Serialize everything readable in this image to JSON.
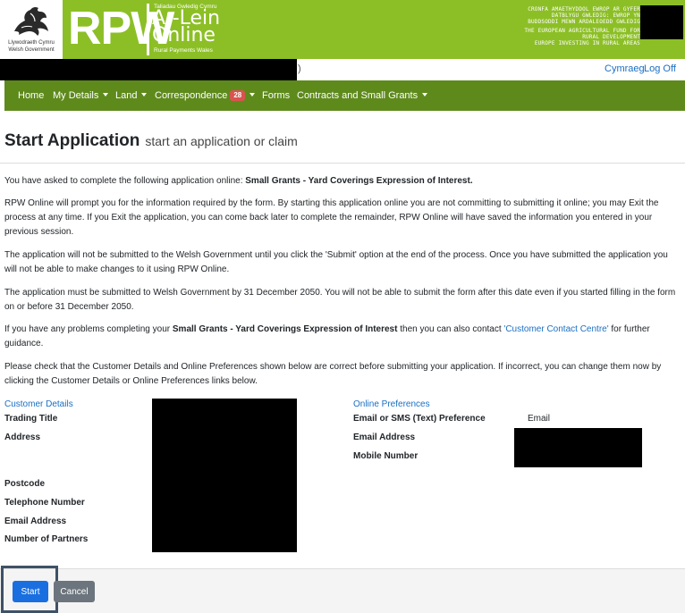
{
  "header": {
    "gov_name_cy": "Llywodraeth Cymru",
    "gov_name_en": "Welsh Government",
    "brand": "RPW",
    "brand_top_small": "Taliadau Gwledig Cymru",
    "brand_line1": "Ar-Lein",
    "brand_line2": "Online",
    "brand_bottom_small": "Rural Payments Wales",
    "eu_lines_cy": [
      "CRONFA AMAETHYDDOL EWROP AR GYFER",
      "DATBLYGU GWLEDIG: EWROP YN",
      "BUDDSODDI MEWN ARDALEOEDD GWLEDIG"
    ],
    "eu_lines_en": [
      "THE EUROPEAN AGRICULTURAL FUND FOR",
      "RURAL DEVELOPMENT",
      "EUROPE INVESTING IN RURAL AREAS"
    ],
    "colors": {
      "green": "#8cbf26",
      "nav_green": "#5e8a1c"
    }
  },
  "utility": {
    "user_suffix": ")",
    "cymraeg": "Cymraeg",
    "logoff": "Log Off"
  },
  "nav": {
    "items": [
      {
        "label": "Home",
        "dropdown": false
      },
      {
        "label": "My Details",
        "dropdown": true
      },
      {
        "label": "Land",
        "dropdown": true
      },
      {
        "label": "Correspondence",
        "dropdown": true,
        "badge": "28"
      },
      {
        "label": "Forms",
        "dropdown": false
      },
      {
        "label": "Contracts and Small Grants",
        "dropdown": true
      }
    ]
  },
  "page": {
    "title": "Start Application",
    "subtitle": "start an application or claim",
    "para1_pre": "You have asked to complete the following application online: ",
    "para1_bold": "Small Grants - Yard Coverings Expression of Interest.",
    "para2": "RPW Online will prompt you for the information required by the form. By starting this application online you are not committing to submitting it online; you may Exit the process at any time. If you Exit the application, you can come back later to complete the remainder, RPW Online will have saved the information you entered in your previous session.",
    "para3": "The application will not be submitted to the Welsh Government until you click the 'Submit' option at the end of the process. Once you have submitted the application you will not be able to make changes to it using RPW Online.",
    "para4": "The application must be submitted to Welsh Government by 31 December 2050. You will not be able to submit the form after this date even if you started filling in the form on or before 31 December 2050.",
    "para5_pre": "If you have any problems completing your ",
    "para5_bold": "Small Grants - Yard Coverings Expression of Interest",
    "para5_mid": " then you can also contact ",
    "para5_link": "'Customer Contact Centre'",
    "para5_post": " for further guidance.",
    "para6": "Please check that the Customer Details and Online Preferences shown below are correct before submitting your application. If incorrect, you can change them now by clicking the Customer Details or Online Preferences links below."
  },
  "customer": {
    "title": "Customer Details",
    "labels": {
      "trading_title": "Trading Title",
      "address": "Address",
      "postcode": "Postcode",
      "telephone": "Telephone Number",
      "email": "Email Address",
      "partners": "Number of Partners"
    }
  },
  "preferences": {
    "title": "Online Preferences",
    "labels": {
      "contact_pref": "Email or SMS (Text) Preference",
      "email": "Email Address",
      "mobile": "Mobile Number"
    },
    "contact_pref_value": "Email"
  },
  "actions": {
    "start": "Start",
    "cancel": "Cancel"
  }
}
